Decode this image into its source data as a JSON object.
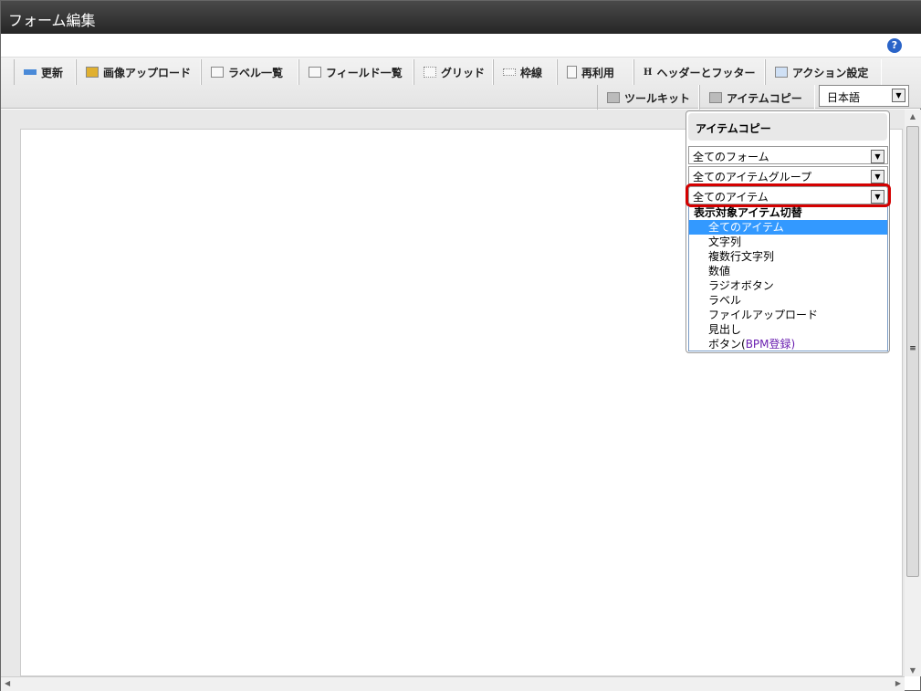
{
  "title": "フォーム編集",
  "help_icon": "?",
  "tabs": [
    "更新",
    "画像アップロード",
    "ラベル一覧",
    "フィールド一覧",
    "グリッド",
    "枠線",
    "再利用",
    "ヘッダーとフッター",
    "アクション設定"
  ],
  "tabs2": [
    "ツールキット",
    "アイテムコピー"
  ],
  "language": "日本語",
  "panel": {
    "title": "アイテムコピー",
    "form_select": "全てのフォーム",
    "group_select": "全てのアイテムグループ",
    "item_select": "全てのアイテム",
    "group_label": "表示対象アイテム切替",
    "options": [
      "全てのアイテム",
      "文字列",
      "複数行文字列",
      "数値",
      "ラジオボタン",
      "ラベル",
      "ファイルアップロード",
      "見出し"
    ],
    "last_option_prefix": "ボタン(",
    "last_option_highlight": "BPM登録",
    "last_option_suffix": ")"
  }
}
